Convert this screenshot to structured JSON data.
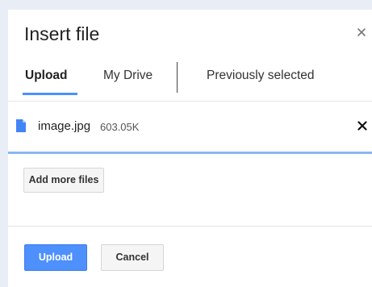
{
  "dialog": {
    "title": "Insert file",
    "close_icon": "close-icon"
  },
  "tabs": [
    {
      "label": "Upload",
      "active": true
    },
    {
      "label": "My Drive",
      "active": false
    },
    {
      "label": "Previously selected",
      "active": false
    }
  ],
  "file": {
    "icon": "document-icon",
    "name": "image.jpg",
    "size": "603.05K",
    "remove_icon": "close-icon"
  },
  "buttons": {
    "add_more": "Add more files",
    "upload": "Upload",
    "cancel": "Cancel"
  },
  "colors": {
    "accent": "#4d90fe",
    "file_icon": "#4285f4",
    "progress_line": "#8ab8f0"
  }
}
